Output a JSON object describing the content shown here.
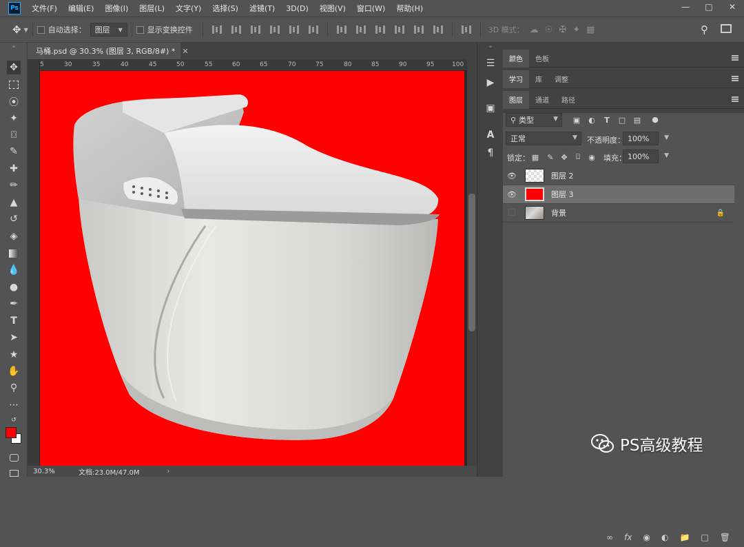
{
  "app": {
    "logo": "Ps"
  },
  "menu": [
    "文件(F)",
    "编辑(E)",
    "图像(I)",
    "图层(L)",
    "文字(Y)",
    "选择(S)",
    "滤镜(T)",
    "3D(D)",
    "视图(V)",
    "窗口(W)",
    "帮助(H)"
  ],
  "options": {
    "auto_select_label": "自动选择：",
    "auto_select_value": "图层",
    "show_transform_label": "显示变换控件",
    "mode_3d_label": "3D 模式："
  },
  "document": {
    "tab_title": "马桶.psd @ 30.3% (图层 3, RGB/8#) *",
    "ruler_ticks": [
      "5",
      "30",
      "35",
      "40",
      "45",
      "50",
      "55",
      "60",
      "65",
      "70",
      "75",
      "80",
      "85",
      "90",
      "95",
      "100"
    ],
    "canvas_color": "#ff0000"
  },
  "status": {
    "zoom": "30.3%",
    "doc_size": "文档:23.0M/47.0M"
  },
  "panels": {
    "color_tabs": [
      "颜色",
      "色板"
    ],
    "learn_tabs": [
      "学习",
      "库",
      "调整"
    ],
    "layer_tabs": [
      "图层",
      "通道",
      "路径"
    ],
    "filter_kind": "类型",
    "blend_mode": "正常",
    "opacity_label": "不透明度：",
    "opacity_value": "100%",
    "lock_label": "锁定：",
    "fill_label": "填充：",
    "fill_value": "100%"
  },
  "layers": [
    {
      "name": "图层 2",
      "visible": true,
      "selected": false,
      "thumb": "toilet-transparent"
    },
    {
      "name": "图层 3",
      "visible": true,
      "selected": true,
      "thumb": "red-fill"
    },
    {
      "name": "背景",
      "visible": false,
      "selected": false,
      "locked": true,
      "thumb": "toilet-photo"
    }
  ],
  "watermark": "PS高级教程",
  "colors": {
    "foreground": "#ff0000",
    "background": "#ffffff",
    "accent": "#31a8ff"
  }
}
